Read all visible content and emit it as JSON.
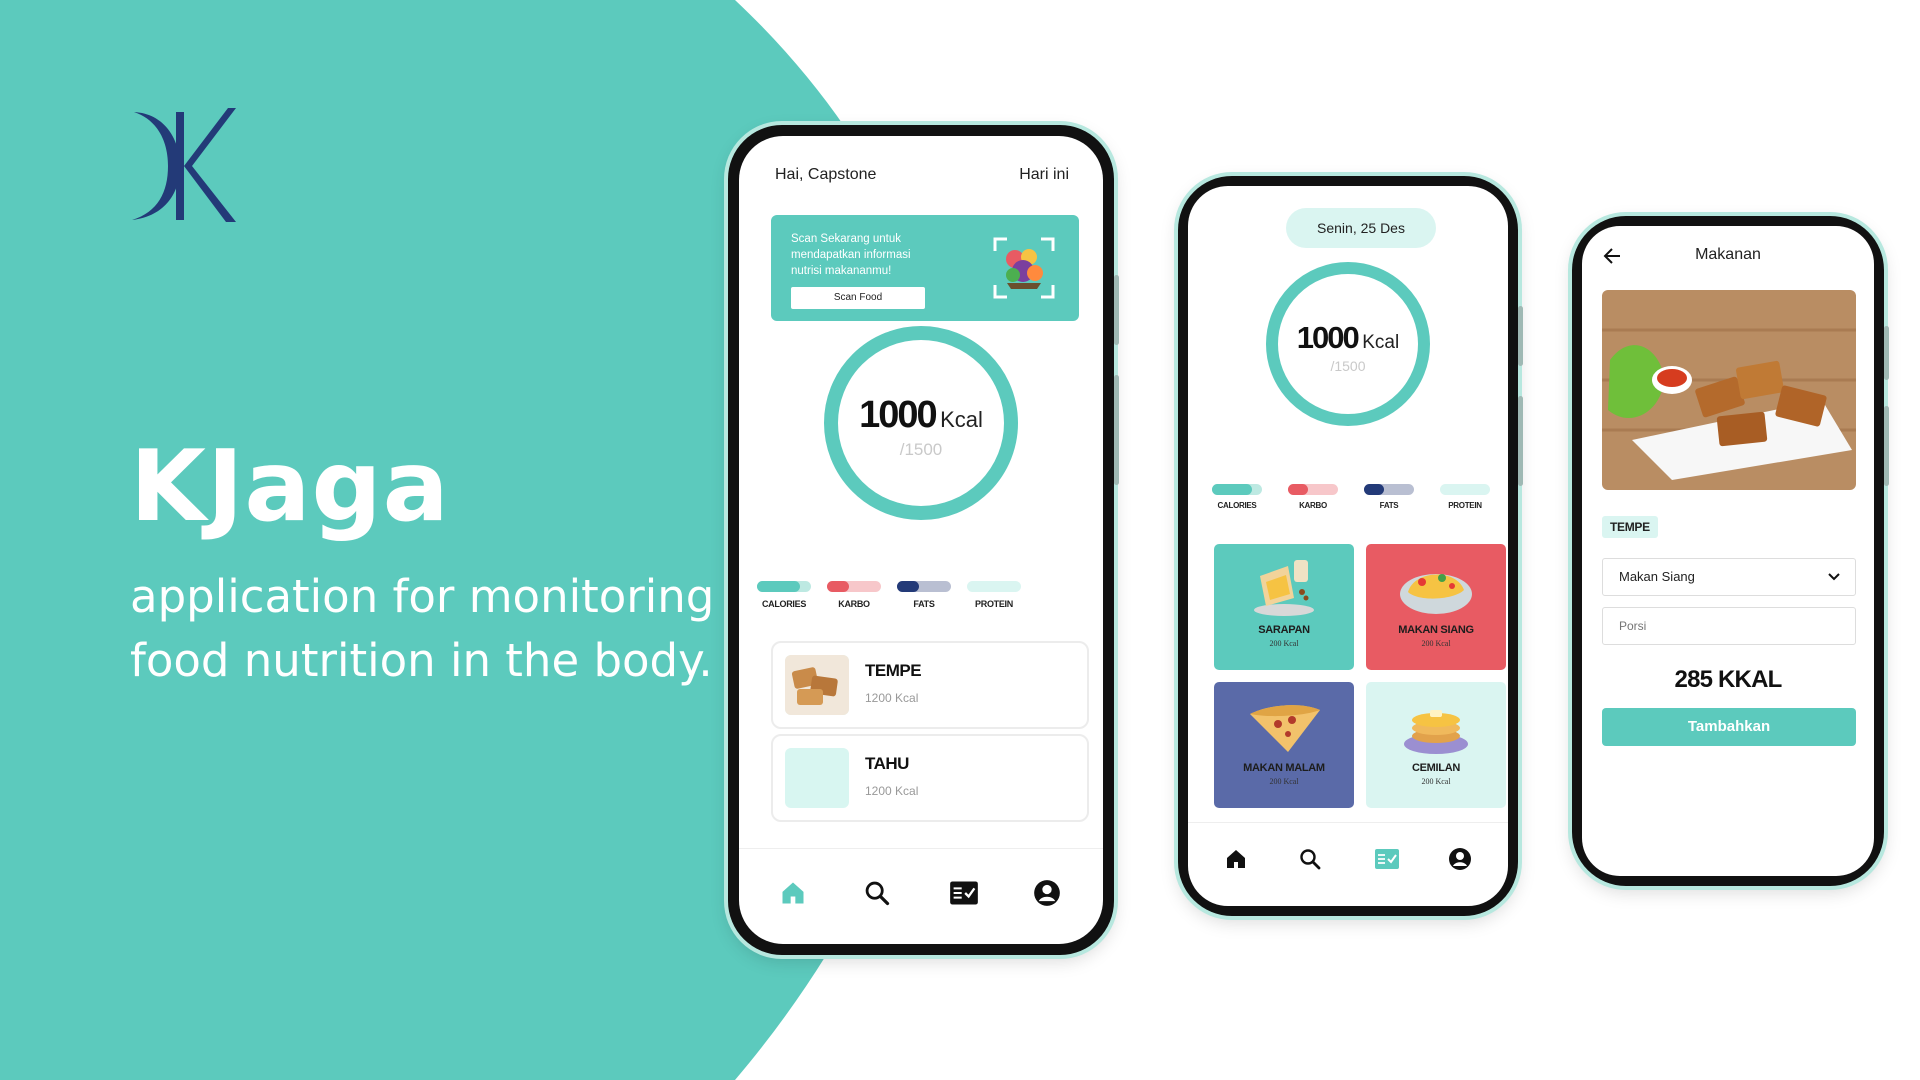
{
  "brand": {
    "name": "KJaga",
    "tagline_line1": "application for monitoring",
    "tagline_line2": "food nutrition in the body.",
    "colors": {
      "teal": "#5ccabd",
      "navy": "#233a78",
      "white": "#ffffff"
    }
  },
  "home_screen": {
    "greeting": "Hai, Capstone",
    "date_label": "Hari ini",
    "scan_card": {
      "text": "Scan Sekarang untuk mendapatkan informasi nutrisi makananmu!",
      "button_label": "Scan Food"
    },
    "calories": {
      "value": "1000",
      "unit": "Kcal",
      "target": "/1500"
    },
    "macros": [
      {
        "label": "CALORIES",
        "fill": 0.8,
        "color": "#5ccabd",
        "track": "#bde9e2"
      },
      {
        "label": "KARBO",
        "fill": 0.4,
        "color": "#e85b63",
        "track": "#f7c7ca"
      },
      {
        "label": "FATS",
        "fill": 0.4,
        "color": "#233a78",
        "track": "#b9bfd2"
      },
      {
        "label": "PROTEIN",
        "fill": 0.0,
        "color": "#5ccabd",
        "track": "#daf5f1"
      }
    ],
    "foods": [
      {
        "name": "TEMPE",
        "kcal": "1200 Kcal"
      },
      {
        "name": "TAHU",
        "kcal": "1200 Kcal"
      }
    ],
    "nav": [
      "home-icon",
      "search-icon",
      "checklist-icon",
      "account-icon"
    ]
  },
  "meals_screen": {
    "date": "Senin, 25 Des",
    "calories": {
      "value": "1000",
      "unit": "Kcal",
      "target": "/1500"
    },
    "macros": [
      {
        "label": "CALORIES",
        "fill": 0.8,
        "color": "#5ccabd",
        "track": "#bde9e2"
      },
      {
        "label": "KARBO",
        "fill": 0.4,
        "color": "#e85b63",
        "track": "#f7c7ca"
      },
      {
        "label": "FATS",
        "fill": 0.4,
        "color": "#233a78",
        "track": "#b9bfd2"
      },
      {
        "label": "PROTEIN",
        "fill": 0.0,
        "color": "#5ccabd",
        "track": "#daf5f1"
      }
    ],
    "tiles": [
      {
        "name": "SARAPAN",
        "kcal": "200 Kcal",
        "color": "#5ccabd"
      },
      {
        "name": "MAKAN SIANG",
        "kcal": "200 Kcal",
        "color": "#e85b63"
      },
      {
        "name": "MAKAN MALAM",
        "kcal": "200 Kcal",
        "color": "#5a6aa8"
      },
      {
        "name": "CEMILAN",
        "kcal": "200 Kcal",
        "color": "#daf5f1"
      }
    ],
    "nav": [
      "home-icon",
      "search-icon",
      "checklist-icon",
      "account-icon"
    ]
  },
  "food_detail_screen": {
    "title": "Makanan",
    "food_tag": "TEMPE",
    "meal_select": "Makan Siang",
    "portion_placeholder": "Porsi",
    "total": "285 KKAL",
    "add_button": "Tambahkan"
  }
}
